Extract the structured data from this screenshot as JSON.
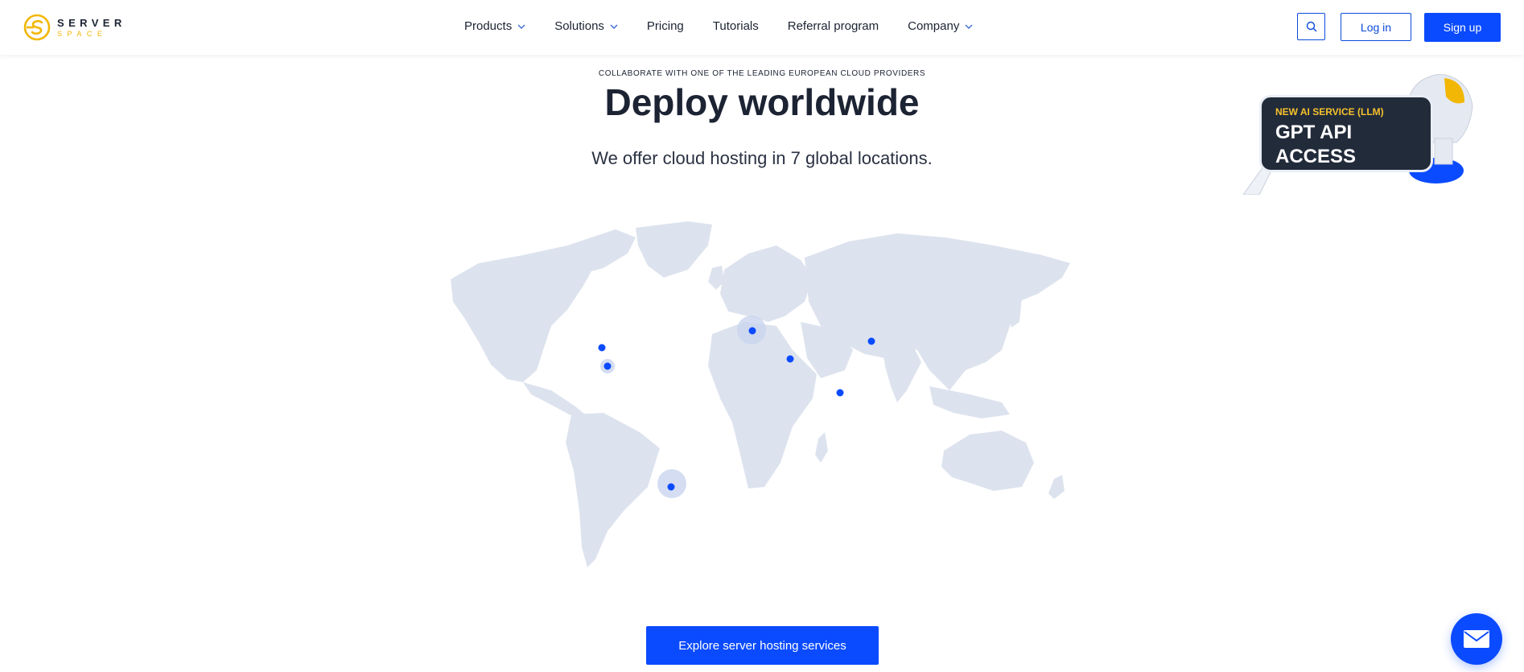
{
  "header": {
    "logo": {
      "word": "SERVER",
      "sub": "SPACE"
    },
    "nav": [
      {
        "label": "Products",
        "dropdown": true
      },
      {
        "label": "Solutions",
        "dropdown": true
      },
      {
        "label": "Pricing",
        "dropdown": false
      },
      {
        "label": "Tutorials",
        "dropdown": false
      },
      {
        "label": "Referral program",
        "dropdown": false
      },
      {
        "label": "Company",
        "dropdown": true
      }
    ],
    "search_icon": "search-icon",
    "login_label": "Log in",
    "signup_label": "Sign up"
  },
  "hero": {
    "eyebrow": "COLLABORATE WITH ONE OF THE LEADING EUROPEAN CLOUD PROVIDERS",
    "title": "Deploy worldwide",
    "subtitle": "We offer cloud hosting in 7 global locations."
  },
  "promo": {
    "tag": "NEW AI SERVICE (LLM)",
    "title": "GPT API ACCESS"
  },
  "cta": {
    "label": "Explore server hosting services"
  },
  "colors": {
    "accent": "#0b4bff",
    "brand_yellow": "#f2b705",
    "map_land": "#dde3ee",
    "dark": "#1c2333"
  }
}
